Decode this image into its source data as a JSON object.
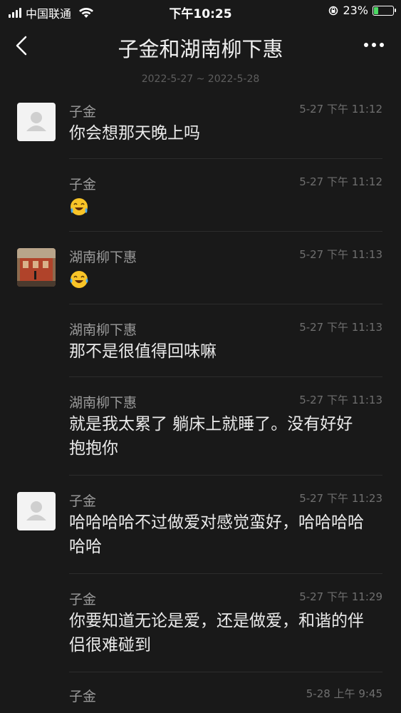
{
  "status_bar": {
    "carrier": "中国联通",
    "time": "下午10:25",
    "battery": "23%"
  },
  "nav": {
    "title": "子金和湖南柳下惠"
  },
  "date_range": "2022-5-27 ~ 2022-5-28",
  "messages": [
    {
      "sender": "子金",
      "time": "5-27 下午 11:12",
      "text": "你会想那天晚上吗"
    },
    {
      "sender": "子金",
      "time": "5-27 下午 11:12",
      "text": ""
    },
    {
      "sender": "湖南柳下惠",
      "time": "5-27 下午 11:13",
      "text": ""
    },
    {
      "sender": "湖南柳下惠",
      "time": "5-27 下午 11:13",
      "text": "那不是很值得回味嘛"
    },
    {
      "sender": "湖南柳下惠",
      "time": "5-27 下午 11:13",
      "text_lines": [
        "就是我太累了 躺床上就睡了。没有好好",
        "抱抱你"
      ]
    },
    {
      "sender": "子金",
      "time": "5-27 下午 11:23",
      "text_lines": [
        "哈哈哈哈不过做爱对感觉蛮好，哈哈哈哈",
        "哈哈"
      ]
    },
    {
      "sender": "子金",
      "time": "5-27 下午 11:29",
      "text_lines": [
        "你要知道无论是爱，还是做爱，和谐的伴",
        "侣很难碰到"
      ]
    },
    {
      "sender": "子金",
      "time": "5-28 上午 9:45",
      "text": ""
    }
  ]
}
